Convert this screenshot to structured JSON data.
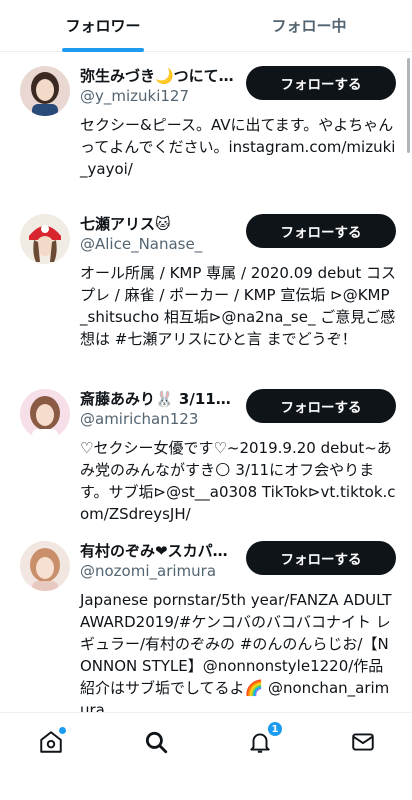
{
  "tabs": [
    {
      "label": "フォロワー",
      "active": true
    },
    {
      "label": "フォロー中",
      "active": false
    }
  ],
  "follow_label": "フォローする",
  "users": [
    {
      "name": "弥生みづき🌙つにて…",
      "handle": "@y_mizuki127",
      "bio": "セクシー&ピース。AVに出てます。やよちゃんってよんでください。instagram.com/mizuki_yayoi/"
    },
    {
      "name": "七瀬アリス🐱",
      "handle": "@Alice_Nanase_",
      "bio": "オール所属 / KMP 専属 / 2020.09 debut コスプレ / 麻雀 / ポーカー / KMP 宣伝垢 ⊳@KMP_shitsucho 相互垢⊳@na2na_se_ ご意見ご感想は #七瀬アリスにひと言 までどうぞ！"
    },
    {
      "name": "斎藤あみり🐰 3/11オ…",
      "handle": "@amirichan123",
      "bio": "♡セクシー女優です♡~2019.9.20 debut~あみ党のみんながすき🌕 3/11にオフ会やります。サブ垢⊳@st__a0308 TikTok⊳vt.tiktok.com/ZSdreysJH/"
    },
    {
      "name": "有村のぞみ❤スカパ…",
      "handle": "@nozomi_arimura",
      "bio": "Japanese pornstar/5th year/FANZA ADULT AWARD2019/#ケンコバのバコバコナイト レギュラー/有村のぞみの #のんのんらじお/【NONNON STYLE】@nonnonstyle1220/作品紹介はサブ垢でしてるよ🌈 @nonchan_arimura"
    }
  ],
  "bottom_nav": [
    {
      "icon": "home-icon"
    },
    {
      "icon": "search-icon"
    },
    {
      "icon": "bell-icon",
      "badge": "1"
    },
    {
      "icon": "mail-icon"
    }
  ],
  "colors": {
    "accent": "#1d9bf0",
    "text": "#0f1419",
    "muted": "#536471",
    "button": "#0f1419"
  }
}
